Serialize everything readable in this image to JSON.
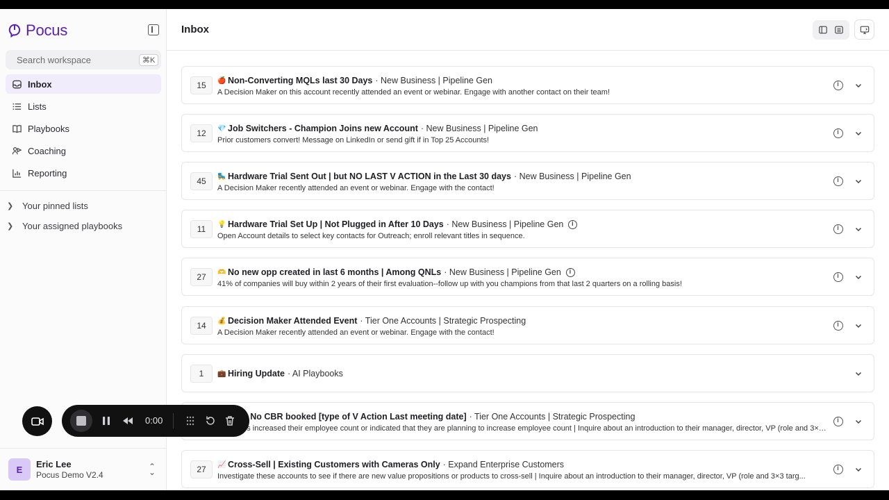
{
  "app": {
    "brand": "Pocus",
    "accent_color": "#5b21b6"
  },
  "sidebar": {
    "search": {
      "placeholder": "Search workspace",
      "shortcut": "⌘K"
    },
    "nav": [
      {
        "label": "Inbox",
        "icon": "inbox-icon",
        "active": true
      },
      {
        "label": "Lists",
        "icon": "list-icon"
      },
      {
        "label": "Playbooks",
        "icon": "book-icon"
      },
      {
        "label": "Coaching",
        "icon": "coaching-icon"
      },
      {
        "label": "Reporting",
        "icon": "bar-chart-icon"
      }
    ],
    "groups": [
      {
        "label": "Your pinned lists"
      },
      {
        "label": "Your assigned playbooks"
      }
    ],
    "user": {
      "initial": "E",
      "name": "Eric Lee",
      "workspace": "Pocus Demo V2.4"
    }
  },
  "main": {
    "title": "Inbox",
    "cards": [
      {
        "count": "15",
        "emoji": "🍎",
        "title": "Non-Converting MQLs last 30 Days",
        "category": "· New Business | Pipeline Gen",
        "desc": "A Decision Maker on this account recently attended an event or webinar. Engage with another contact on their team!"
      },
      {
        "count": "12",
        "emoji": "💎",
        "title": "Job Switchers - Champion Joins new Account",
        "category": "· New Business | Pipeline Gen",
        "desc": "Prior customers convert! Message on LinkedIn or send gift if in Top 25 Accounts!"
      },
      {
        "count": "45",
        "emoji": "🛼",
        "title": "Hardware Trial Sent Out | but NO LAST V ACTION in the Last 30 days",
        "category": "· New Business | Pipeline Gen",
        "desc": "A Decision Maker recently attended an event or webinar. Engage with the contact!"
      },
      {
        "count": "11",
        "emoji": "💡",
        "title": "Hardware Trial Set Up | Not Plugged in After 10 Days",
        "category": "· New Business | Pipeline Gen",
        "desc": "Open Account details to select key contacts for Outreach; enroll relevant titles in sequence.",
        "title_info": true
      },
      {
        "count": "27",
        "emoji": "🫶",
        "title": "No new opp created in last 6 months | Among QNLs",
        "category": "· New Business | Pipeline Gen",
        "desc": "41% of companies will buy within 2 years of their first evaluation--follow up with you champions from that last 2 quarters on a rolling basis!",
        "title_info": true
      },
      {
        "count": "14",
        "emoji": "💰",
        "title": "Decision Maker Attended Event ",
        "category": "· Tier One Accounts | Strategic Prospecting",
        "desc": "A Decision Maker recently attended an event or webinar. Engage with the contact!"
      },
      {
        "count": "1",
        "emoji": "💼",
        "title": "Hiring Update",
        "category": "· AI Playbooks",
        "desc": "",
        "no_info": true
      },
      {
        "count": "",
        "emoji": "",
        "title": "anded | No CBR booked [type of V Action Last meeting date]",
        "category": "· Tier One Accounts | Strategic Prospecting",
        "desc": "ompanies increased their employee count or indicated that they are planning to increase employee count | Inquire about an introduction to their manager, director, VP (role and 3×3 targ..."
      },
      {
        "count": "27",
        "emoji": "📈",
        "title": "Cross-Sell | Existing Customers with Cameras Only",
        "category": "· Expand Enterprise Customers",
        "desc": "Investigate these accounts to see if there are new value propositions or products to cross-sell | Inquire about an introduction to their manager, director, VP (role and 3×3 targ..."
      }
    ]
  },
  "recorder": {
    "time": "0:00"
  }
}
